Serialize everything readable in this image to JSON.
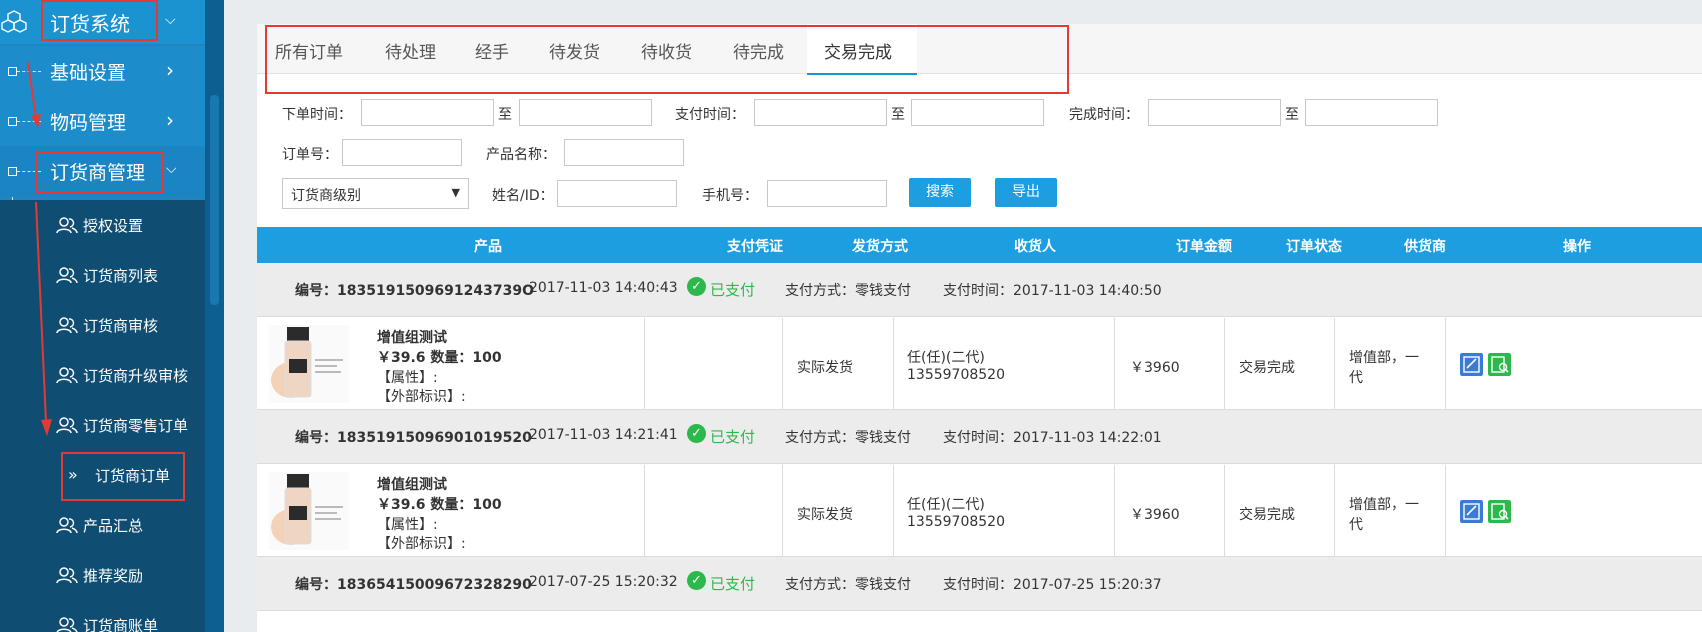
{
  "sidebar": {
    "system_title": "订货系统",
    "groups": [
      {
        "label": "基础设置"
      },
      {
        "label": "物码管理"
      },
      {
        "label": "订货商管理"
      }
    ],
    "items": [
      {
        "label": "授权设置"
      },
      {
        "label": "订货商列表"
      },
      {
        "label": "订货商审核"
      },
      {
        "label": "订货商升级审核"
      },
      {
        "label": "订货商零售订单"
      },
      {
        "label": "订货商订单",
        "active": true
      },
      {
        "label": "产品汇总"
      },
      {
        "label": "推荐奖励"
      },
      {
        "label": "订货商账单"
      }
    ],
    "active_marker": "»"
  },
  "tabs": [
    {
      "label": "所有订单"
    },
    {
      "label": "待处理"
    },
    {
      "label": "经手"
    },
    {
      "label": "待发货"
    },
    {
      "label": "待收货"
    },
    {
      "label": "待完成"
    },
    {
      "label": "交易完成",
      "active": true
    }
  ],
  "filters": {
    "order_time_label": "下单时间：",
    "pay_time_label": "支付时间：",
    "done_time_label": "完成时间：",
    "to": "至",
    "order_no_label": "订单号：",
    "product_name_label": "产品名称：",
    "level_select": "订货商级别",
    "name_id_label": "姓名/ID：",
    "phone_label": "手机号：",
    "search_btn": "搜索",
    "export_btn": "导出"
  },
  "table": {
    "headers": {
      "product": "产品",
      "voucher": "支付凭证",
      "ship": "发货方式",
      "receiver": "收货人",
      "amount": "订单金额",
      "status": "订单状态",
      "supplier": "供货商",
      "ops": "操作"
    },
    "orders": [
      {
        "no": "编号：1835191509691243739O",
        "time": "2017-11-03 14:40:43",
        "paid": "已支付",
        "pay_method": "支付方式：零钱支付",
        "pay_time": "支付时间：2017-11-03 14:40:50",
        "product_name": "增值组测试",
        "price_qty": "￥39.6 数量：100",
        "attr": "【属性】:",
        "ext": "【外部标识】:",
        "ship": "实际发货",
        "receiver_name": "任(任)(二代)",
        "receiver_phone": "13559708520",
        "amount": "￥3960",
        "status": "交易完成",
        "supplier_line1": "增值部，一",
        "supplier_line2": "代"
      },
      {
        "no": "编号：18351915096901019520",
        "time": "2017-11-03 14:21:41",
        "paid": "已支付",
        "pay_method": "支付方式：零钱支付",
        "pay_time": "支付时间：2017-11-03 14:22:01",
        "product_name": "增值组测试",
        "price_qty": "￥39.6 数量：100",
        "attr": "【属性】:",
        "ext": "【外部标识】:",
        "ship": "实际发货",
        "receiver_name": "任(任)(二代)",
        "receiver_phone": "13559708520",
        "amount": "￥3960",
        "status": "交易完成",
        "supplier_line1": "增值部，一",
        "supplier_line2": "代"
      },
      {
        "no": "编号：18365415009672328290",
        "time": "2017-07-25 15:20:32",
        "paid": "已支付",
        "pay_method": "支付方式：零钱支付",
        "pay_time": "支付时间：2017-07-25 15:20:37"
      }
    ]
  },
  "colors": {
    "accent": "#1c9ee0",
    "paid": "#2db84c",
    "annotation": "#e53935"
  }
}
